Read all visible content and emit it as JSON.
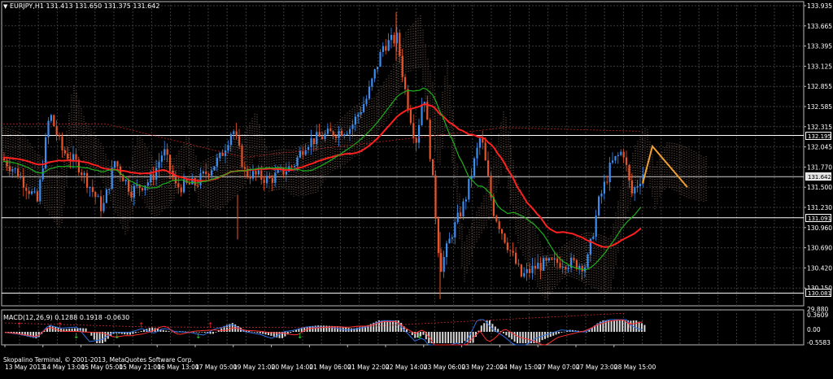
{
  "main_title": "EURJPY,H1  131.413 131.650 131.375 131.642",
  "macd_title": "MACD(12,26,9) 0.1288 0.1918 -0.0630",
  "copyright": "Skopalino Terminal, © 2001-2013, MetaQuotes Software Corp.",
  "price_scale": [
    "133.935",
    "133.665",
    "133.395",
    "133.125",
    "132.855",
    "132.585",
    "132.315",
    "132.045",
    "131.770",
    "131.500",
    "131.230",
    "130.960",
    "130.690",
    "130.420",
    "130.150"
  ],
  "price_tags": [
    {
      "label": "132.195",
      "style": "line"
    },
    {
      "label": "131.642",
      "style": "current"
    },
    {
      "label": "131.091",
      "style": "line"
    },
    {
      "label": "130.081",
      "style": "line"
    }
  ],
  "macd_scale": [
    "0.3609",
    "0.00",
    "-0.5583"
  ],
  "macd_low_label": "29.880",
  "time_axis": [
    "13 May 2013",
    "14 May 13:00",
    "15 May 05:00",
    "15 May 21:00",
    "16 May 13:00",
    "17 May 05:00",
    "19 May 21:00",
    "20 May 14:00",
    "21 May 06:00",
    "21 May 22:00",
    "22 May 14:00",
    "23 May 06:00",
    "23 May 22:00",
    "24 May 15:00",
    "27 May 07:00",
    "27 May 23:00",
    "28 May 15:00"
  ],
  "colors": {
    "bull": "#3b8df0",
    "bear": "#e8542a",
    "ma_red": "#ff2020",
    "ma_green": "#1db01d",
    "cloud": "#d9a88a",
    "projection": "#f0a030"
  }
}
